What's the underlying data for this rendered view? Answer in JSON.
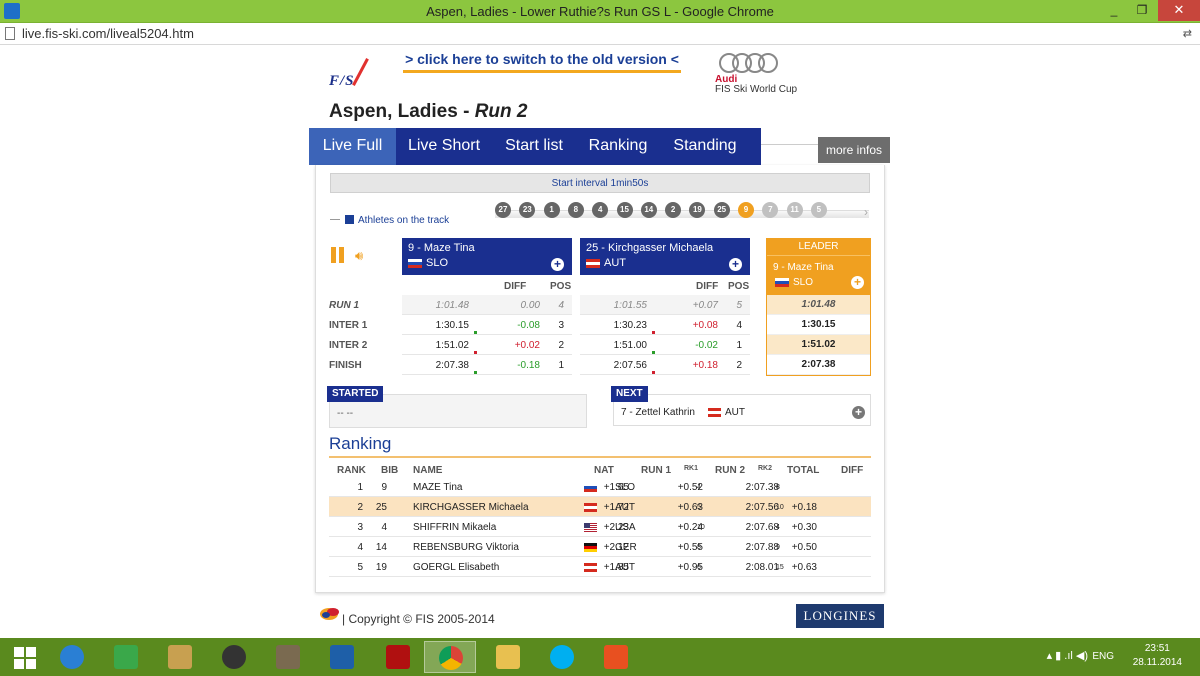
{
  "window": {
    "title": "Aspen, Ladies - Lower Ruthie?s Run GS L - Google Chrome",
    "min": "_",
    "max": "❐",
    "close": "✕"
  },
  "address": {
    "url": "live.fis-ski.com/liveal5204.htm"
  },
  "header": {
    "fis_logo": "F/S",
    "old_version_link": "> click here to switch to the old version <",
    "audi_brand": "Audi",
    "audi_sub": "FIS Ski World Cup",
    "race_title": "Aspen, Ladies - ",
    "race_run": "Run 2"
  },
  "tabs": [
    {
      "label": "Live Full",
      "active": true
    },
    {
      "label": "Live Short"
    },
    {
      "label": "Start list"
    },
    {
      "label": "Ranking"
    },
    {
      "label": "Standing"
    }
  ],
  "more_infos": "more infos",
  "start_interval": "Start interval 1min50s",
  "athletes_on_track": "Athletes on the track",
  "track_bibs": [
    {
      "bib": "27",
      "state": "done"
    },
    {
      "bib": "23",
      "state": "done"
    },
    {
      "bib": "1",
      "state": "done"
    },
    {
      "bib": "8",
      "state": "done"
    },
    {
      "bib": "4",
      "state": "done"
    },
    {
      "bib": "15",
      "state": "done"
    },
    {
      "bib": "14",
      "state": "done"
    },
    {
      "bib": "2",
      "state": "done"
    },
    {
      "bib": "19",
      "state": "done"
    },
    {
      "bib": "25",
      "state": "done"
    },
    {
      "bib": "9",
      "state": "current"
    },
    {
      "bib": "7",
      "state": "upcoming"
    },
    {
      "bib": "11",
      "state": "upcoming"
    },
    {
      "bib": "5",
      "state": "upcoming"
    }
  ],
  "racer_left": {
    "name": "9 - Maze Tina",
    "nat": "SLO"
  },
  "racer_right": {
    "name": "25 - Kirchgasser Michaela",
    "nat": "AUT"
  },
  "leader": {
    "header": "LEADER",
    "name": "9 - Maze Tina",
    "nat": "SLO",
    "times": [
      "1:01.48",
      "1:30.15",
      "1:51.02",
      "2:07.38"
    ]
  },
  "columns": {
    "diff": "DIFF",
    "pos": "POS"
  },
  "rows": [
    "RUN 1",
    "INTER 1",
    "INTER 2",
    "FINISH"
  ],
  "left_times": [
    {
      "time": "1:01.48",
      "diff": "0.00",
      "pos": "4"
    },
    {
      "time": "1:30.15",
      "diff": "-0.08",
      "pos": "3"
    },
    {
      "time": "1:51.02",
      "diff": "+0.02",
      "pos": "2"
    },
    {
      "time": "2:07.38",
      "diff": "-0.18",
      "pos": "1"
    }
  ],
  "right_times": [
    {
      "time": "1:01.55",
      "diff": "+0.07",
      "pos": "5"
    },
    {
      "time": "1:30.23",
      "diff": "+0.08",
      "pos": "4"
    },
    {
      "time": "1:51.00",
      "diff": "-0.02",
      "pos": "1"
    },
    {
      "time": "2:07.56",
      "diff": "+0.18",
      "pos": "2"
    }
  ],
  "started": {
    "label": "STARTED",
    "value": "-- --"
  },
  "next": {
    "label": "NEXT",
    "value": "7 - Zettel Kathrin",
    "nat": "AUT"
  },
  "ranking": {
    "title": "Ranking",
    "headers": {
      "rank": "RANK",
      "bib": "BIB",
      "name": "NAME",
      "nat": "NAT",
      "run1": "RUN 1",
      "rk1": "RK1",
      "run2": "RUN 2",
      "rk2": "RK2",
      "total": "TOTAL",
      "diff": "DIFF"
    },
    "rows": [
      {
        "rank": "1",
        "bib": "9",
        "name": "MAZE Tina",
        "nat": "SLO",
        "run1": "+1.65",
        "rk1": "4",
        "run2": "+0.52",
        "rk2": "8",
        "total": "2:07.38",
        "diff": ""
      },
      {
        "rank": "2",
        "bib": "25",
        "name": "KIRCHGASSER Michaela",
        "nat": "AUT",
        "run1": "+1.72",
        "rk1": "5",
        "run2": "+0.63",
        "rk2": "10",
        "total": "2:07.56",
        "diff": "+0.18"
      },
      {
        "rank": "3",
        "bib": "4",
        "name": "SHIFFRIN Mikaela",
        "nat": "USA",
        "run1": "+2.23",
        "rk1": "10",
        "run2": "+0.24",
        "rk2": "4",
        "total": "2:07.68",
        "diff": "+0.30"
      },
      {
        "rank": "4",
        "bib": "14",
        "name": "REBENSBURG Viktoria",
        "nat": "GER",
        "run1": "+2.12",
        "rk1": "8",
        "run2": "+0.55",
        "rk2": "9",
        "total": "2:07.88",
        "diff": "+0.50"
      },
      {
        "rank": "5",
        "bib": "19",
        "name": "GOERGL Elisabeth",
        "nat": "AUT",
        "run1": "+1.85",
        "rk1": "6",
        "run2": "+0.95",
        "rk2": "15",
        "total": "2:08.01",
        "diff": "+0.63"
      }
    ]
  },
  "footer": {
    "copyright": "| Copyright © FIS 2005-2014",
    "sponsor": "LONGINES"
  },
  "taskbar": {
    "lang": "ENG",
    "time": "23:51",
    "date": "28.11.2014"
  },
  "colors": {
    "navy": "#1a2f8f",
    "orange": "#f0a020",
    "taskbar": "#5a8a1e",
    "titlebar": "#8cc63f"
  }
}
